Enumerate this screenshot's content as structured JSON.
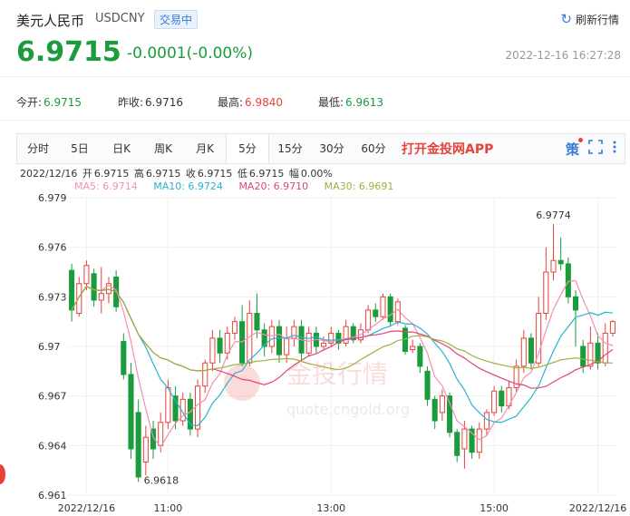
{
  "header": {
    "name": "美元人民币",
    "code": "USDCNY",
    "badge": "交易中",
    "refresh_label": "刷新行情",
    "price": "6.9715",
    "change": "-0.0001(-0.00%)",
    "timestamp": "2022-12-16 16:27:28"
  },
  "stats": [
    {
      "label": "今开:",
      "value": "6.9715",
      "color": "#1a9b3c"
    },
    {
      "label": "昨收:",
      "value": "6.9716",
      "color": "#333333"
    },
    {
      "label": "最高:",
      "value": "6.9840",
      "color": "#e8413a"
    },
    {
      "label": "最低:",
      "value": "6.9613",
      "color": "#1a9b3c"
    }
  ],
  "tabs": [
    {
      "label": "分时"
    },
    {
      "label": "5日"
    },
    {
      "label": "日K"
    },
    {
      "label": "周K"
    },
    {
      "label": "月K"
    },
    {
      "label": "5分"
    },
    {
      "label": "15分"
    },
    {
      "label": "30分"
    },
    {
      "label": "60分"
    }
  ],
  "active_tab": "5分",
  "app_link": "打开金投网APP",
  "tool_icons": {
    "strategy_label": "策",
    "fullscreen": "fullscreen-icon",
    "more": "more-icon"
  },
  "ohlc": {
    "date": "2022/12/16",
    "open_label": "开",
    "open": "6.9715",
    "high_label": "高",
    "high": "6.9715",
    "close_label": "收",
    "close": "6.9715",
    "low_label": "低",
    "low": "6.9715",
    "amp_label": "幅",
    "amp": "0.00%"
  },
  "ma": [
    {
      "label": "MA5: 6.9714",
      "color": "#f48fb1"
    },
    {
      "label": "MA10: 6.9724",
      "color": "#26b5d0"
    },
    {
      "label": "MA20: 6.9710",
      "color": "#e0447a"
    },
    {
      "label": "MA30: 6.9691",
      "color": "#9bb33a"
    }
  ],
  "watermark": {
    "text1": "金投行情",
    "text2": "quote.cngold.org"
  },
  "chart_data": {
    "type": "candlestick",
    "ylim": [
      6.961,
      6.979
    ],
    "yticks": [
      "6.979",
      "6.976",
      "6.973",
      "6.97",
      "6.967",
      "6.964",
      "6.961"
    ],
    "xticks": [
      {
        "label": "2022/12/16",
        "index": 2
      },
      {
        "label": "11:00",
        "index": 13
      },
      {
        "label": "13:00",
        "index": 35
      },
      {
        "label": "15:00",
        "index": 57
      },
      {
        "label": "2022/12/16",
        "index": 71
      }
    ],
    "annotations": {
      "max": "6.9774",
      "min": "6.9618"
    },
    "candles": [
      [
        6.9746,
        6.9722,
        6.975,
        6.9715
      ],
      [
        6.972,
        6.9738,
        6.9742,
        6.9718
      ],
      [
        6.9738,
        6.9749,
        6.9752,
        6.9734
      ],
      [
        6.9744,
        6.9728,
        6.9747,
        6.9724
      ],
      [
        6.9728,
        6.9732,
        6.9748,
        6.972
      ],
      [
        6.9732,
        6.9738,
        6.9742,
        6.9726
      ],
      [
        6.9742,
        6.9724,
        6.9746,
        6.9721
      ],
      [
        6.9703,
        6.9683,
        6.9708,
        6.968
      ],
      [
        6.9683,
        6.9638,
        6.969,
        6.9632
      ],
      [
        6.966,
        6.9621,
        6.9668,
        6.9618
      ],
      [
        6.963,
        6.9645,
        6.9652,
        6.9622
      ],
      [
        6.965,
        6.9638,
        6.9655,
        6.9632
      ],
      [
        6.964,
        6.9654,
        6.966,
        6.9636
      ],
      [
        6.9654,
        6.9675,
        6.968,
        6.965
      ],
      [
        6.967,
        6.9655,
        6.9676,
        6.965
      ],
      [
        6.9655,
        6.9668,
        6.9672,
        6.9652
      ],
      [
        6.9668,
        6.965,
        6.9672,
        6.9646
      ],
      [
        6.965,
        6.9676,
        6.968,
        6.9645
      ],
      [
        6.9676,
        6.969,
        6.9692,
        6.9672
      ],
      [
        6.969,
        6.9705,
        6.971,
        6.9685
      ],
      [
        6.9705,
        6.9696,
        6.971,
        6.969
      ],
      [
        6.9696,
        6.9708,
        6.9712,
        6.9692
      ],
      [
        6.9708,
        6.9715,
        6.9718,
        6.9704
      ],
      [
        6.9715,
        6.969,
        6.9725,
        6.9688
      ],
      [
        6.969,
        6.972,
        6.9728,
        6.9688
      ],
      [
        6.972,
        6.971,
        6.9732,
        6.9705
      ],
      [
        6.971,
        6.97,
        6.9714,
        6.9694
      ],
      [
        6.97,
        6.9712,
        6.9716,
        6.9696
      ],
      [
        6.9712,
        6.9695,
        6.9716,
        6.969
      ],
      [
        6.9695,
        6.9705,
        6.9712,
        6.969
      ],
      [
        6.9705,
        6.9712,
        6.9716,
        6.97
      ],
      [
        6.9712,
        6.9696,
        6.9716,
        6.9692
      ],
      [
        6.9696,
        6.9708,
        6.9712,
        6.9694
      ],
      [
        6.9708,
        6.97,
        6.9712,
        6.9696
      ],
      [
        6.97,
        6.9702,
        6.9706,
        6.9698
      ],
      [
        6.9702,
        6.9708,
        6.9712,
        6.97
      ],
      [
        6.9708,
        6.9702,
        6.971,
        6.9698
      ],
      [
        6.9702,
        6.9712,
        6.9716,
        6.97
      ],
      [
        6.9712,
        6.9704,
        6.9714,
        6.9702
      ],
      [
        6.9704,
        6.971,
        6.9714,
        6.9702
      ],
      [
        6.971,
        6.9722,
        6.9725,
        6.9708
      ],
      [
        6.9722,
        6.9718,
        6.9726,
        6.9715
      ],
      [
        6.9718,
        6.973,
        6.9732,
        6.9716
      ],
      [
        6.973,
        6.9715,
        6.9732,
        6.9712
      ],
      [
        6.9715,
        6.9727,
        6.9729,
        6.9713
      ],
      [
        6.9711,
        6.9697,
        6.9713,
        6.9695
      ],
      [
        6.9698,
        6.97,
        6.9704,
        6.9696
      ],
      [
        6.97,
        6.9688,
        6.9702,
        6.9684
      ],
      [
        6.9685,
        6.9668,
        6.9688,
        6.9664
      ],
      [
        6.9668,
        6.9655,
        6.967,
        6.965
      ],
      [
        6.966,
        6.967,
        6.9674,
        6.9655
      ],
      [
        6.967,
        6.9648,
        6.9672,
        6.9645
      ],
      [
        6.9648,
        6.9634,
        6.965,
        6.963
      ],
      [
        6.9638,
        6.965,
        6.9655,
        6.9626
      ],
      [
        6.965,
        6.9636,
        6.9652,
        6.9632
      ],
      [
        6.9636,
        6.965,
        6.9654,
        6.9632
      ],
      [
        6.965,
        6.966,
        6.9662,
        6.9646
      ],
      [
        6.966,
        6.9673,
        6.9676,
        6.9658
      ],
      [
        6.9673,
        6.9664,
        6.9676,
        6.966
      ],
      [
        6.9664,
        6.9675,
        6.9679,
        6.9662
      ],
      [
        6.9675,
        6.9688,
        6.9692,
        6.9672
      ],
      [
        6.9688,
        6.9705,
        6.971,
        6.9684
      ],
      [
        6.9705,
        6.969,
        6.9708,
        6.9686
      ],
      [
        6.969,
        6.972,
        6.973,
        6.9688
      ],
      [
        6.972,
        6.9745,
        6.976,
        6.9716
      ],
      [
        6.9745,
        6.9752,
        6.9774,
        6.974
      ],
      [
        6.9752,
        6.975,
        6.9766,
        6.9746
      ],
      [
        6.975,
        6.973,
        6.9754,
        6.9726
      ],
      [
        6.973,
        6.9722,
        6.9734,
        6.97
      ],
      [
        6.97,
        6.9688,
        6.9704,
        6.9684
      ],
      [
        6.9688,
        6.9702,
        6.9712,
        6.9686
      ],
      [
        6.9702,
        6.969,
        6.9708,
        6.9686
      ],
      [
        6.969,
        6.9708,
        6.9714,
        6.9688
      ],
      [
        6.9708,
        6.9715,
        6.9716,
        6.9706
      ]
    ]
  }
}
